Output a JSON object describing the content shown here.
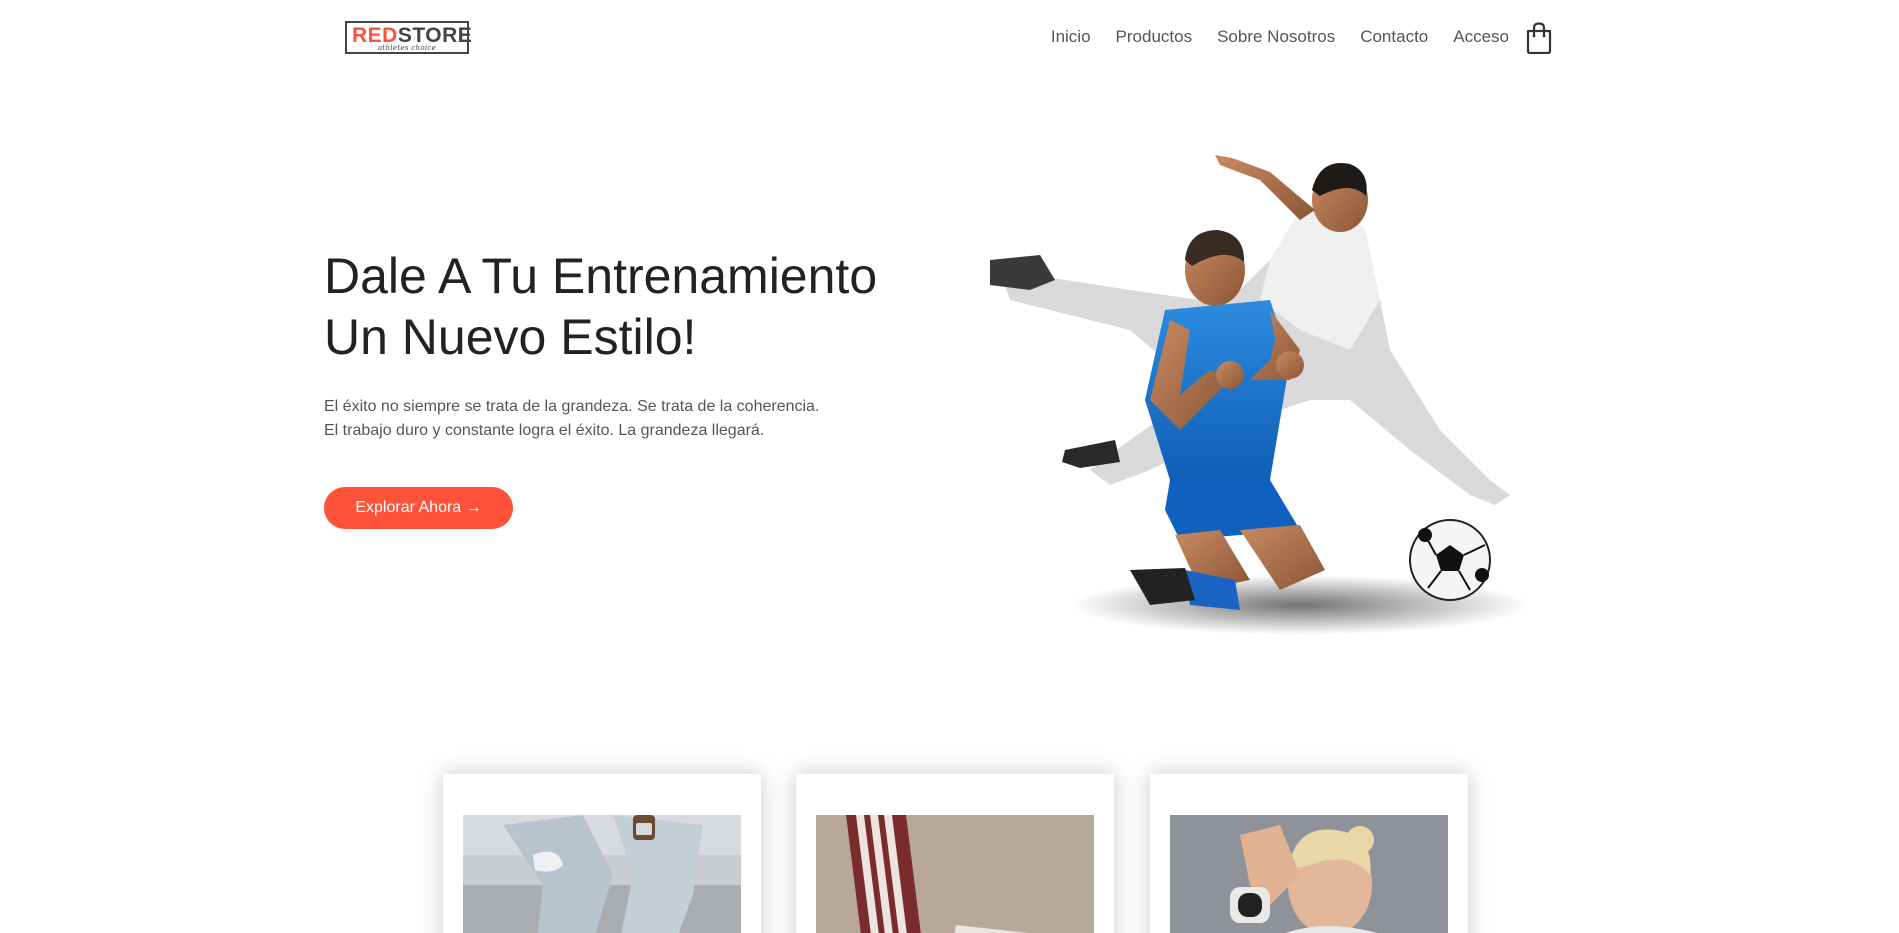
{
  "brand": {
    "logo_part1": "RED",
    "logo_part2": "STORE",
    "logo_tagline": "athletes choice"
  },
  "nav": {
    "items": [
      {
        "label": "Inicio"
      },
      {
        "label": "Productos"
      },
      {
        "label": "Sobre Nosotros"
      },
      {
        "label": "Contacto"
      },
      {
        "label": "Acceso"
      }
    ],
    "cart_icon": "shopping-bag-icon"
  },
  "hero": {
    "title": "Dale A Tu Entrenamiento\nUn Nuevo Estilo!",
    "description": "El éxito no siempre se trata de la grandeza. Se trata de la coherencia.\nEl trabajo duro y constante logra el éxito. La grandeza llegará.",
    "cta_label": "Explorar Ahora →",
    "image": "soccer-players-image"
  },
  "categories": [
    {
      "image": "torn-jeans-category-image"
    },
    {
      "image": "striped-track-pants-category-image"
    },
    {
      "image": "woman-smartwatch-category-image"
    }
  ],
  "colors": {
    "accent": "#ff523b",
    "text_dark": "#222222",
    "text_muted": "#555555"
  }
}
